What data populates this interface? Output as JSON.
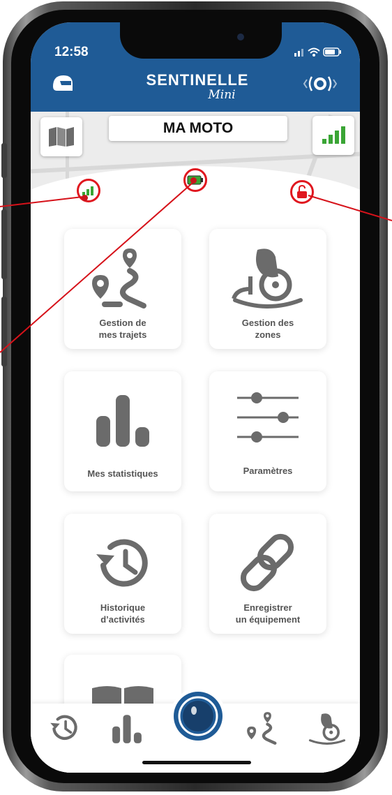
{
  "status_bar": {
    "time": "12:58"
  },
  "header": {
    "brand_title": "SENTINELLE",
    "brand_subtitle": "Mini",
    "left_icon": "helmet-icon",
    "right_icon": "signal-emitter-icon"
  },
  "map": {
    "vehicle_name": "MA MOTO",
    "left_button_icon": "map-icon",
    "right_button_icon": "signal-strength-icon"
  },
  "status_indicators": [
    {
      "name": "gsm-signal",
      "icon": "signal-bars-icon"
    },
    {
      "name": "battery",
      "icon": "battery-icon"
    },
    {
      "name": "lock",
      "icon": "unlocked-padlock-icon"
    }
  ],
  "tiles": [
    {
      "label": "Gestion de\nmes trajets",
      "icon": "route-pin-icon"
    },
    {
      "label": "Gestion des\nzones",
      "icon": "moto-zone-icon"
    },
    {
      "label": "Mes statistiques",
      "icon": "bar-chart-icon"
    },
    {
      "label": "Paramètres",
      "icon": "sliders-icon"
    },
    {
      "label": "Historique\nd’activités",
      "icon": "history-clock-icon"
    },
    {
      "label": "Enregistrer\nun équipement",
      "icon": "chain-link-icon"
    }
  ],
  "tabbar": [
    {
      "icon": "history-clock-icon"
    },
    {
      "icon": "bar-chart-icon"
    },
    {
      "icon": "helmet-center-icon"
    },
    {
      "icon": "route-pin-icon"
    },
    {
      "icon": "moto-zone-icon"
    }
  ],
  "colors": {
    "header_blue": "#1f5b96",
    "alert_red": "#e0171f",
    "icon_grey": "#6b6b6b",
    "signal_green": "#3aa535"
  }
}
